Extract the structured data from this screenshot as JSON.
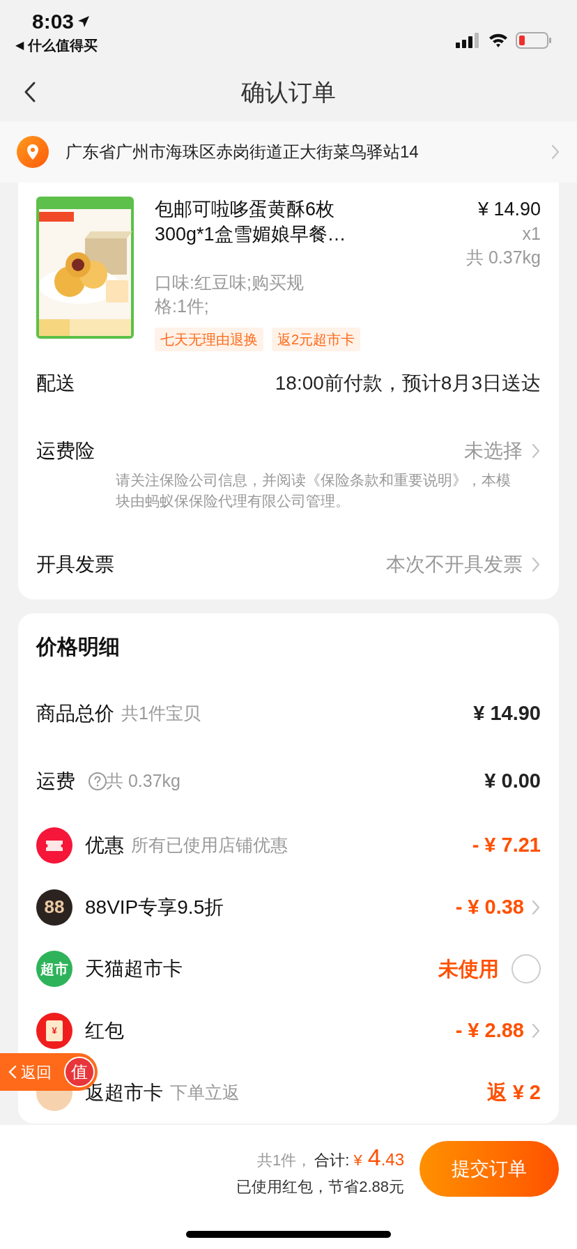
{
  "status_bar": {
    "time": "8:03",
    "back_glyph": "◀",
    "back_app": "什么值得买"
  },
  "nav": {
    "title": "确认订单"
  },
  "address": {
    "text": "广东省广州市海珠区赤岗街道正大街菜鸟驿站14"
  },
  "product": {
    "image": {
      "kind": "picture"
    },
    "title": "包邮可啦哆蛋黄酥6枚300g*1盒雪媚娘早餐…",
    "spec": "口味:红豆味;购买规格:1件;",
    "price": "¥ 14.90",
    "quantity": "x1",
    "weight": "共 0.37kg",
    "tags": [
      "七天无理由退换",
      "返2元超市卡"
    ]
  },
  "order_rows": [
    {
      "label": "配送",
      "value": "18:00前付款，预计8月3日送达",
      "muted": false,
      "chevron": false
    },
    {
      "label": "运费险",
      "value": "未选择",
      "muted": true,
      "chevron": true,
      "note": "请关注保险公司信息，并阅读《保险条款和重要说明》，本模块由蚂蚁保保险代理有限公司管理。"
    },
    {
      "label": "开具发票",
      "value": "本次不开具发票",
      "muted": true,
      "chevron": true
    }
  ],
  "price_detail": {
    "title": "价格明细",
    "rows": [
      {
        "kind": "charge",
        "label": "商品总价",
        "sub": "共1件宝贝",
        "value": "¥ 14.90",
        "chevron": false
      },
      {
        "kind": "charge",
        "label": "运费",
        "sub": "共 0.37kg",
        "help": true,
        "value": "¥ 0.00",
        "chevron": false
      },
      {
        "kind": "discount",
        "color": "#f5163a",
        "label": "优惠",
        "sub": "所有已使用店铺优惠",
        "value": "- ¥ 7.21",
        "chevron": false
      },
      {
        "kind": "discount",
        "color": "#2b2320",
        "badge": "88",
        "label": "88VIP专享9.5折",
        "value": "- ¥ 0.38",
        "chevron": true
      },
      {
        "kind": "toggle",
        "color": "#2fb35a",
        "badge": "超市",
        "label": "天猫超市卡",
        "value": "未使用",
        "checked": false
      },
      {
        "kind": "discount",
        "color": "#f01d1d",
        "badge": "¥",
        "label": "红包",
        "value": "- ¥ 2.88",
        "chevron": true
      },
      {
        "kind": "discount",
        "color": "#f6d3ae",
        "label": "返超市卡",
        "sub": "下单立返",
        "value": "返 ¥ 2",
        "chevron": false
      }
    ]
  },
  "footer": {
    "count": "共1件，",
    "total_label": "合计:",
    "currency": "¥",
    "total_int": "4",
    "total_dec": ".43",
    "saving": "已使用红包，节省2.88元",
    "submit": "提交订单"
  },
  "float_back": {
    "label": "返回",
    "badge": "值"
  }
}
